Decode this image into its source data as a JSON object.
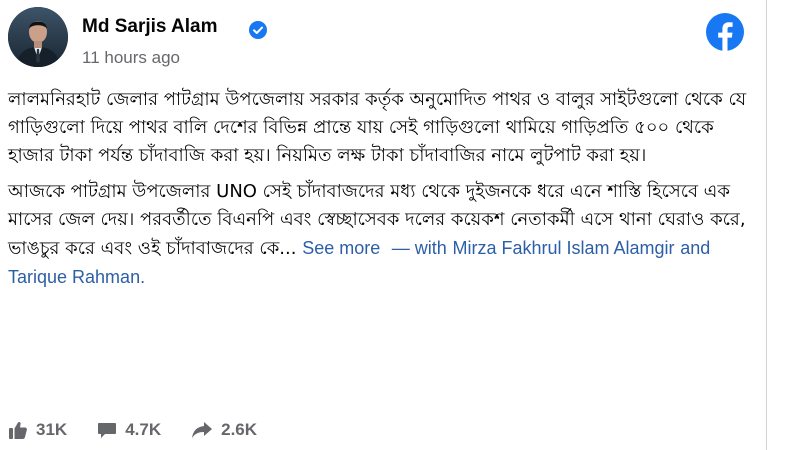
{
  "post": {
    "author": {
      "name": "Md Sarjis Alam",
      "verified": true,
      "avatar_icon": "avatar-photo"
    },
    "timestamp": "11 hours ago",
    "platform_icon": "facebook-icon",
    "paragraph_1": "লালমনিরহাট জেলার পাটগ্রাম উপজেলায় সরকার কর্তৃক অনুমোদিত পাথর ও বালুর সাইটগুলো থেকে যে গাড়িগুলো দিয়ে পাথর বালি দেশের বিভিন্ন প্রান্তে যায় সেই গাড়িগুলো থামিয়ে গাড়িপ্রতি ৫০০ থেকে হাজার টাকা পর্যন্ত চাঁদাবাজি করা হয়। নিয়মিত লক্ষ টাকা চাঁদাবাজির নামে লুটপাট করা হয়।",
    "paragraph_2": "আজকে পাটগ্রাম উপজেলার UNO সেই চাঁদাবাজদের মধ্য থেকে দুইজনকে ধরে এনে শাস্তি হিসেবে এক মাসের জেল দেয়। পরবর্তীতে বিএনপি এবং স্বেচ্ছাসেবক দলের কয়েকশ নেতাকর্মী এসে থানা ঘেরাও করে, ভাঙচুর করে এবং ওই চাঁদাবাজদের কে...",
    "see_more": "See more",
    "with_prefix": "— with",
    "tagged_1": "Mirza Fakhrul Islam Alamgir",
    "and_text": "and",
    "tagged_2": "Tarique Rahman",
    "tag_end": "."
  },
  "stats": {
    "likes": "31K",
    "comments": "4.7K",
    "shares": "2.6K",
    "like_icon": "thumbs-up-icon",
    "comment_icon": "comment-icon",
    "share_icon": "share-arrow-icon"
  },
  "colors": {
    "facebook_blue": "#1877f2",
    "link_blue": "#2d5ea8",
    "secondary_text": "#65676b"
  }
}
